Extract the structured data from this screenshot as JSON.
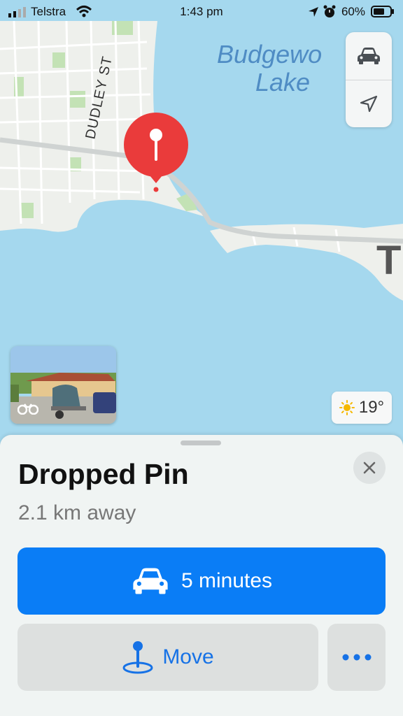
{
  "status_bar": {
    "carrier": "Telstra",
    "time": "1:43 pm",
    "battery_percent": "60%"
  },
  "map": {
    "street_label": "DUDLEY ST",
    "lake_label_line1": "Budgewo",
    "lake_label_line2": "Lake",
    "edge_label": "T",
    "colors": {
      "water": "#a5d8ee",
      "land": "#eef0ec",
      "park": "#c3e2b5",
      "pin": "#ea3b3b"
    }
  },
  "controls": {
    "drive_mode_icon": "car-icon",
    "location_icon": "location-arrow-icon"
  },
  "look_around": {
    "icon": "binoculars-icon"
  },
  "weather": {
    "icon": "sun-icon",
    "temperature": "19°"
  },
  "place_card": {
    "title": "Dropped Pin",
    "distance": "2.1 km away",
    "close_icon": "close-icon",
    "directions_button": {
      "label": "5 minutes",
      "icon": "car-icon",
      "color": "#0a7df6"
    },
    "move_button": {
      "label": "Move",
      "icon": "pin-icon",
      "color": "#1672e6"
    },
    "more_button": {
      "icon": "more-icon"
    }
  }
}
